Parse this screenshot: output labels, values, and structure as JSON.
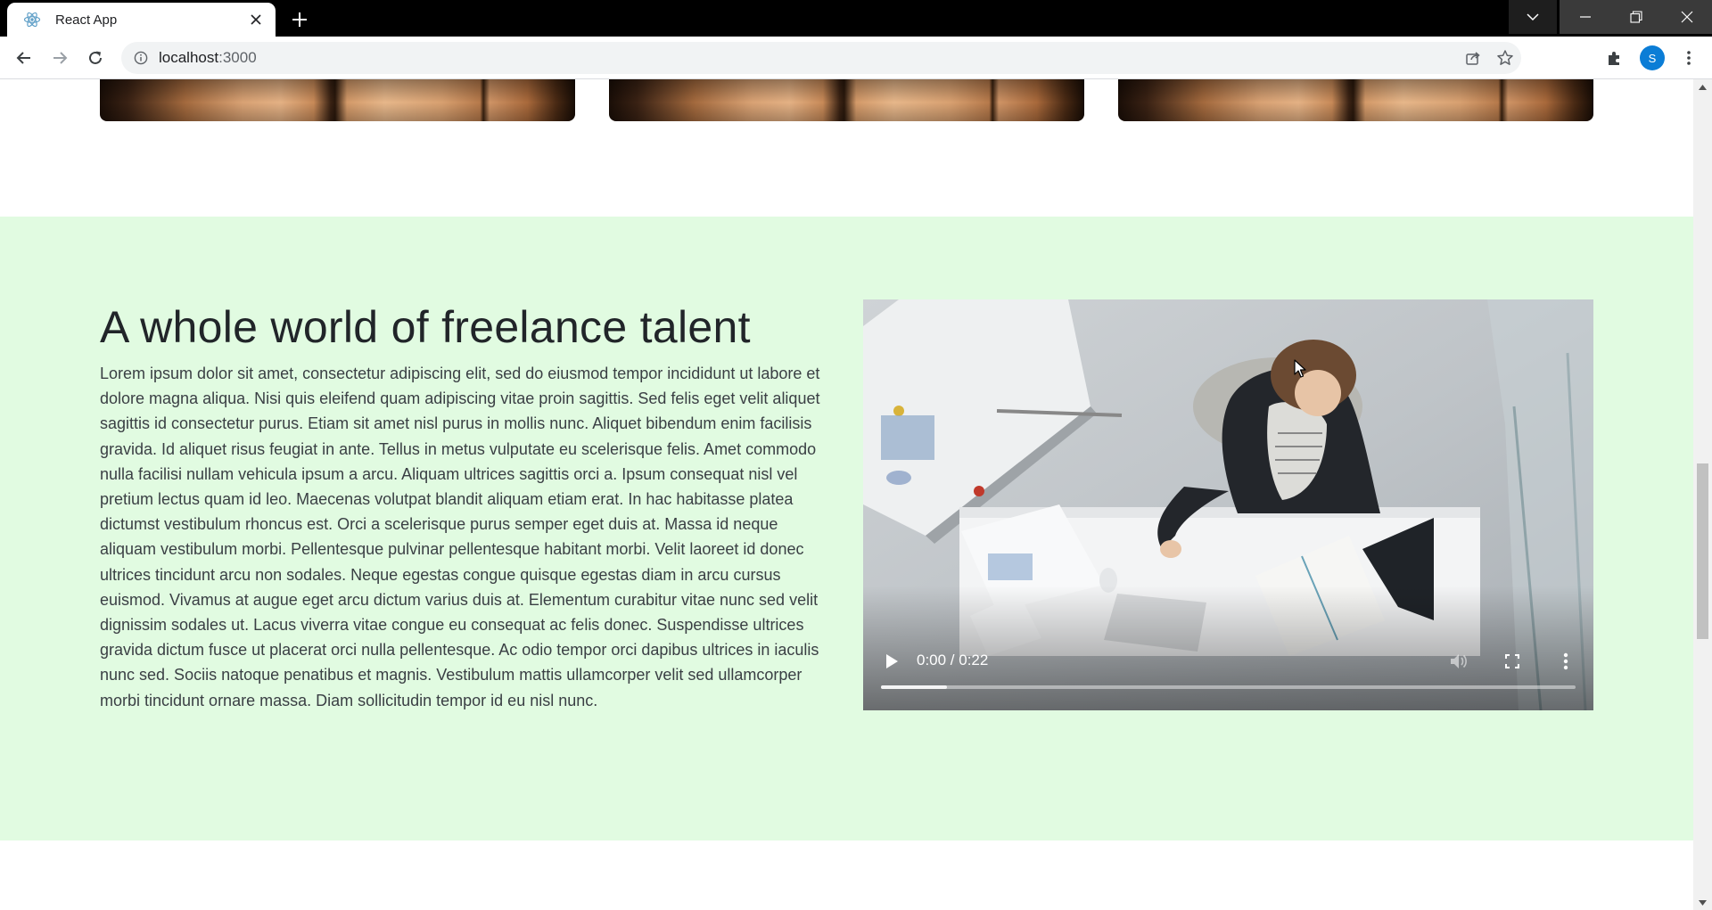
{
  "browser": {
    "tab_title": "React App",
    "url_host": "localhost",
    "url_port": ":3000",
    "profile_initial": "S"
  },
  "talent": {
    "title": "A whole world of freelance talent",
    "body": "Lorem ipsum dolor sit amet, consectetur adipiscing elit, sed do eiusmod tempor incididunt ut labore et dolore magna aliqua. Nisi quis eleifend quam adipiscing vitae proin sagittis. Sed felis eget velit aliquet sagittis id consectetur purus. Etiam sit amet nisl purus in mollis nunc. Aliquet bibendum enim facilisis gravida. Id aliquet risus feugiat in ante. Tellus in metus vulputate eu scelerisque felis. Amet commodo nulla facilisi nullam vehicula ipsum a arcu. Aliquam ultrices sagittis orci a. Ipsum consequat nisl vel pretium lectus quam id leo. Maecenas volutpat blandit aliquam etiam erat. In hac habitasse platea dictumst vestibulum rhoncus est. Orci a scelerisque purus semper eget duis at. Massa id neque aliquam vestibulum morbi. Pellentesque pulvinar pellentesque habitant morbi. Velit laoreet id donec ultrices tincidunt arcu non sodales. Neque egestas congue quisque egestas diam in arcu cursus euismod. Vivamus at augue eget arcu dictum varius duis at. Elementum curabitur vitae nunc sed velit dignissim sodales ut. Lacus viverra vitae congue eu consequat ac felis donec. Suspendisse ultrices gravida dictum fusce ut placerat orci nulla pellentesque. Ac odio tempor orci dapibus ultrices in iaculis nunc sed. Sociis natoque penatibus et magnis. Vestibulum mattis ullamcorper velit sed ullamcorper morbi tincidunt ornare massa. Diam sollicitudin tempor id eu nisl nunc."
  },
  "video": {
    "time": "0:00 / 0:22",
    "buffered_fraction": 0.095
  },
  "colors": {
    "section_bg": "#e1fbe1",
    "heading": "#212529",
    "profile": "#0b7dd6"
  },
  "icons": [
    "react-favicon-icon",
    "close-icon",
    "plus-icon",
    "chevron-down-icon",
    "minimize-icon",
    "restore-icon",
    "window-close-icon",
    "back-arrow-icon",
    "forward-arrow-icon",
    "reload-icon",
    "info-icon",
    "share-icon",
    "star-icon",
    "extensions-icon",
    "kebab-menu-icon",
    "play-icon",
    "volume-icon",
    "fullscreen-icon",
    "more-icon",
    "scroll-up-icon",
    "scroll-down-icon"
  ]
}
